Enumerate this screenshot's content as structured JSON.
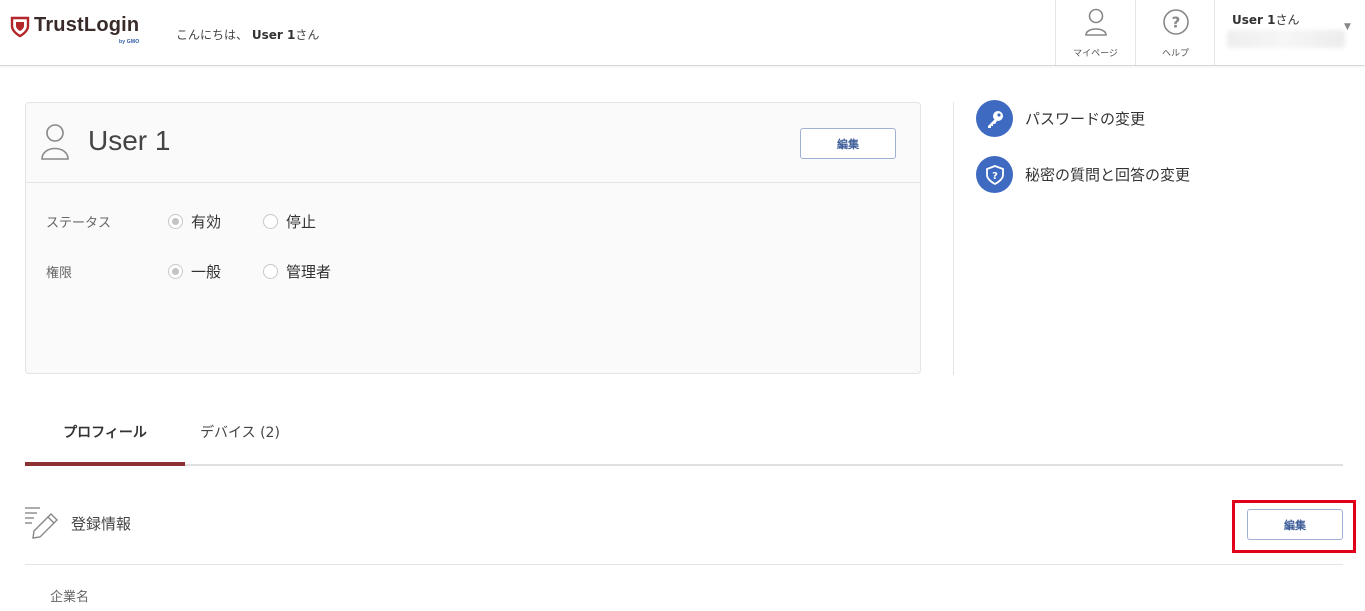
{
  "header": {
    "logo_text": "TrustLogin",
    "logo_sub": "by GMO",
    "greeting_prefix": "こんにちは、",
    "greeting_user": "User 1",
    "greeting_suffix": "さん",
    "nav": [
      {
        "label": "マイページ",
        "icon": "person-icon"
      },
      {
        "label": "ヘルプ",
        "icon": "help-icon"
      }
    ],
    "user_menu": {
      "name": "User 1",
      "suffix": "さん",
      "caret": "▼"
    }
  },
  "profile_card": {
    "name": "User 1",
    "edit_label": "編集",
    "status": {
      "label": "ステータス",
      "options": [
        "有効",
        "停止"
      ],
      "selected": "有効"
    },
    "role": {
      "label": "権限",
      "options": [
        "一般",
        "管理者"
      ],
      "selected": "一般"
    }
  },
  "actions": [
    {
      "label": "パスワードの変更",
      "icon": "key-icon"
    },
    {
      "label": "秘密の質問と回答の変更",
      "icon": "shield-question-icon"
    }
  ],
  "tabs": [
    {
      "label": "プロフィール",
      "active": true
    },
    {
      "label": "デバイス (2)",
      "active": false
    }
  ],
  "section": {
    "title": "登録情報",
    "edit_label": "編集",
    "fields": [
      {
        "label": "企業名"
      }
    ]
  },
  "colors": {
    "accent_blue": "#3e6bc1",
    "tab_active": "#8a3232",
    "highlight": "#e0001a",
    "logo_red": "#b3262a"
  }
}
